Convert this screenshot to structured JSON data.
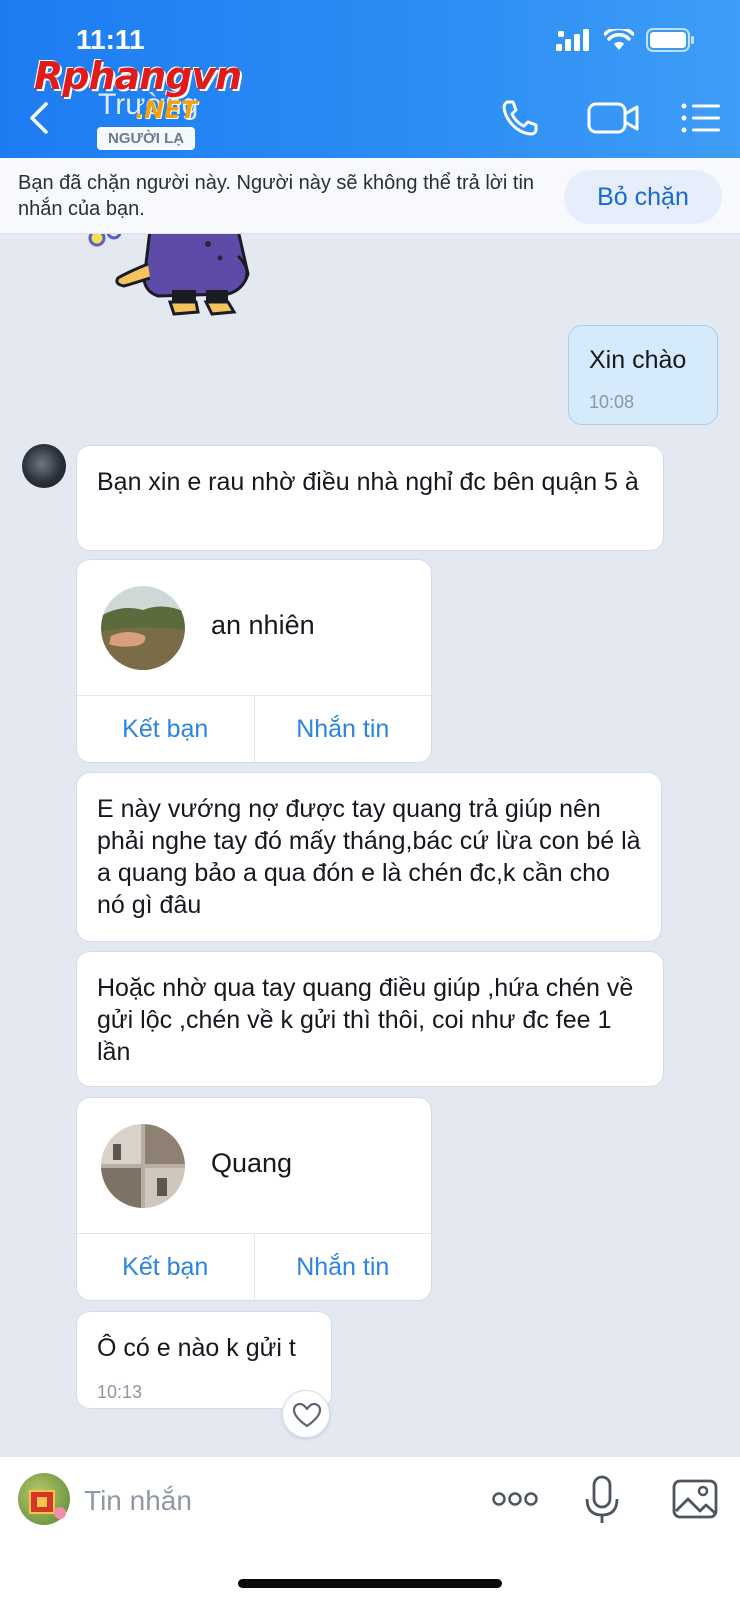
{
  "status_bar": {
    "time": "11:11"
  },
  "header": {
    "contact_name": "Trường",
    "badge": "NGƯỜI LẠ",
    "watermark": "Rphangvn",
    "watermark_suffix": ".NET"
  },
  "block_banner": {
    "text": "Bạn đã chặn người này. Người này sẽ không thể trả lời tin nhắn của bạn.",
    "unblock_label": "Bỏ chặn"
  },
  "messages": {
    "outgoing_1": {
      "text": "Xin chào",
      "time": "10:08"
    },
    "incoming_1": {
      "text": "Bạn xin e rau nhờ điều nhà nghỉ đc bên quận 5 à"
    },
    "card_1": {
      "name": "an nhiên",
      "add_friend": "Kết bạn",
      "message": "Nhắn tin"
    },
    "incoming_2": {
      "text": "E này vướng nợ được tay quang trả giúp nên phải nghe tay đó mấy tháng,bác cứ lừa con bé là a quang bảo a qua đón e là chén đc,k cần cho nó gì đâu"
    },
    "incoming_3": {
      "text": "Hoặc nhờ qua tay quang điều giúp ,hứa chén về gửi lộc ,chén về k gửi thì thôi, coi như đc fee 1 lần"
    },
    "card_2": {
      "name": "Quang",
      "add_friend": "Kết bạn",
      "message": "Nhắn tin"
    },
    "incoming_4": {
      "text": "Ô có e nào k gửi t",
      "time": "10:13"
    }
  },
  "input_bar": {
    "placeholder": "Tin nhắn"
  },
  "icons": {
    "back": "chevron-left-icon",
    "call": "phone-icon",
    "video": "video-icon",
    "menu": "list-icon",
    "reaction": "heart-icon",
    "more": "more-dots-icon",
    "mic": "microphone-icon",
    "image": "image-icon"
  },
  "colors": {
    "header": "#1d7cf2",
    "accent": "#2b83e6",
    "outgoing_bubble": "#d5ebfc",
    "chat_bg": "#e3e8f1"
  }
}
